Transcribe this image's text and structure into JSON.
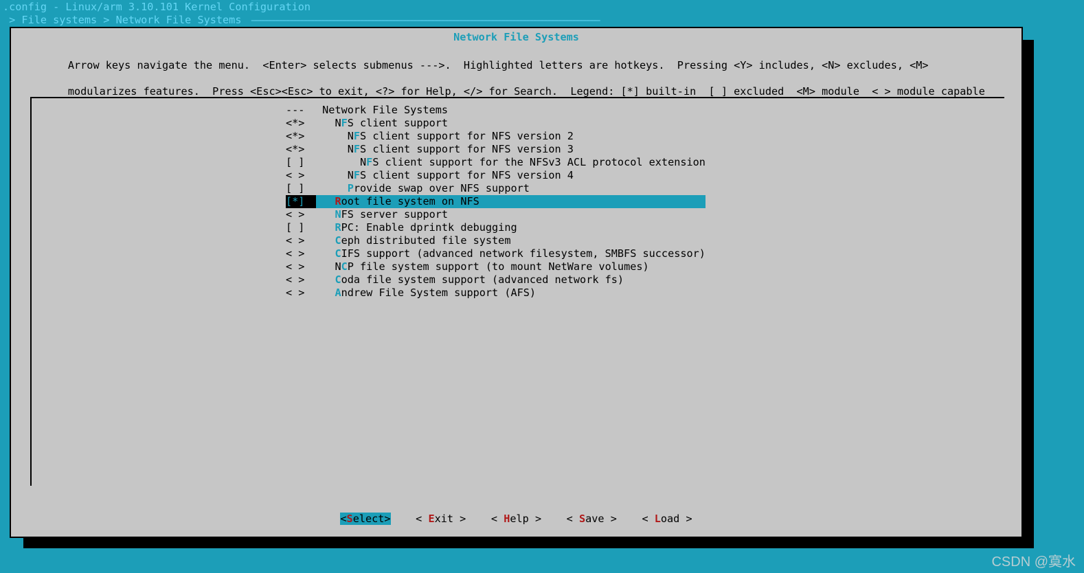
{
  "header": {
    "title": ".config - Linux/arm 3.10.101 Kernel Configuration",
    "breadcrumb": " > File systems > Network File Systems "
  },
  "box": {
    "title": "Network File Systems",
    "instructions_l1": "Arrow keys navigate the menu.  <Enter> selects submenus --->.  Highlighted letters are hotkeys.  Pressing <Y> includes, <N> excludes, <M>",
    "instructions_l2": "modularizes features.  Press <Esc><Esc> to exit, <?> for Help, </> for Search.  Legend: [*] built-in  [ ] excluded  <M> module  < > module capable"
  },
  "menu": {
    "items": [
      {
        "bracket": "---",
        "indent": " ",
        "pre": "",
        "hot": "",
        "post": "Network File Systems",
        "sel": false
      },
      {
        "bracket": "<*>",
        "indent": "   ",
        "pre": "N",
        "hot": "F",
        "post": "S client support",
        "sel": false
      },
      {
        "bracket": "<*>",
        "indent": "     ",
        "pre": "N",
        "hot": "F",
        "post": "S client support for NFS version 2",
        "sel": false
      },
      {
        "bracket": "<*>",
        "indent": "     ",
        "pre": "N",
        "hot": "F",
        "post": "S client support for NFS version 3",
        "sel": false
      },
      {
        "bracket": "[ ]",
        "indent": "       ",
        "pre": "N",
        "hot": "F",
        "post": "S client support for the NFSv3 ACL protocol extension",
        "sel": false
      },
      {
        "bracket": "< >",
        "indent": "     ",
        "pre": "N",
        "hot": "F",
        "post": "S client support for NFS version 4",
        "sel": false
      },
      {
        "bracket": "[ ]",
        "indent": "     ",
        "pre": "",
        "hot": "P",
        "post": "rovide swap over NFS support",
        "sel": false
      },
      {
        "bracket": "[*]",
        "indent": "   ",
        "pre": "",
        "hot": "R",
        "post": "oot file system on NFS",
        "sel": true
      },
      {
        "bracket": "< >",
        "indent": "   ",
        "pre": "",
        "hot": "N",
        "post": "FS server support",
        "sel": false
      },
      {
        "bracket": "[ ]",
        "indent": "   ",
        "pre": "",
        "hot": "R",
        "post": "PC: Enable dprintk debugging",
        "sel": false
      },
      {
        "bracket": "< >",
        "indent": "   ",
        "pre": "",
        "hot": "C",
        "post": "eph distributed file system",
        "sel": false
      },
      {
        "bracket": "< >",
        "indent": "   ",
        "pre": "",
        "hot": "C",
        "post": "IFS support (advanced network filesystem, SMBFS successor)",
        "sel": false
      },
      {
        "bracket": "< >",
        "indent": "   ",
        "pre": "N",
        "hot": "C",
        "post": "P file system support (to mount NetWare volumes)",
        "sel": false
      },
      {
        "bracket": "< >",
        "indent": "   ",
        "pre": "",
        "hot": "C",
        "post": "oda file system support (advanced network fs)",
        "sel": false
      },
      {
        "bracket": "< >",
        "indent": "   ",
        "pre": "",
        "hot": "A",
        "post": "ndrew File System support (AFS)",
        "sel": false
      }
    ]
  },
  "buttons": {
    "items": [
      {
        "open": "<",
        "hot": "S",
        "rest": "elect",
        "close": ">",
        "sel": true
      },
      {
        "open": "< ",
        "hot": "E",
        "rest": "xit ",
        "close": ">",
        "sel": false
      },
      {
        "open": "< ",
        "hot": "H",
        "rest": "elp ",
        "close": ">",
        "sel": false
      },
      {
        "open": "< ",
        "hot": "S",
        "rest": "ave ",
        "close": ">",
        "sel": false
      },
      {
        "open": "< ",
        "hot": "L",
        "rest": "oad ",
        "close": ">",
        "sel": false
      }
    ],
    "gap": "    "
  },
  "watermark": "CSDN @寞水"
}
